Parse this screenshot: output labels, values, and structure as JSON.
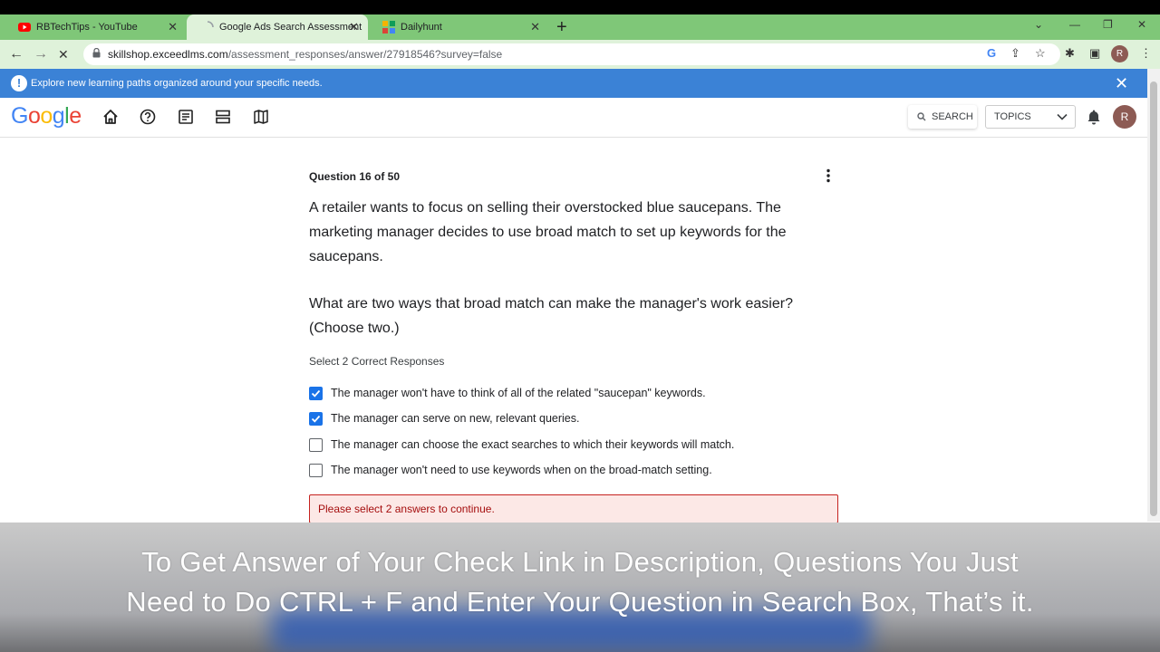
{
  "browser": {
    "tabs": [
      {
        "title": "RBTechTips - YouTube",
        "icon": "youtube-icon"
      },
      {
        "title": "Google Ads Search Assessment",
        "icon": "loading-icon"
      },
      {
        "title": "Dailyhunt",
        "icon": "dailyhunt-icon"
      }
    ],
    "url_host": "skillshop.exceedlms.com",
    "url_path": "/assessment_responses/answer/27918546?survey=false",
    "profile_initial": "R"
  },
  "banner": {
    "text": "Explore new learning paths organized around your specific needs."
  },
  "header": {
    "logo_letters": [
      "G",
      "o",
      "o",
      "g",
      "l",
      "e"
    ],
    "logo_colors": [
      "#4285f4",
      "#ea4335",
      "#fbbc05",
      "#4285f4",
      "#34a853",
      "#ea4335"
    ],
    "search_label": "SEARCH",
    "topics_label": "TOPICS",
    "avatar_initial": "R"
  },
  "question": {
    "number_label": "Question 16 of 50",
    "scenario": "A retailer wants to focus on selling their overstocked blue saucepans. The marketing manager decides to use broad match to set up keywords for the saucepans.",
    "prompt": "What are two ways that broad match can make the manager's work easier? (Choose two.)",
    "instruction": "Select 2 Correct Responses",
    "options": [
      {
        "label": "The manager won't have to think of all of the related \"saucepan\" keywords.",
        "checked": true
      },
      {
        "label": "The manager can serve on new, relevant queries.",
        "checked": true
      },
      {
        "label": "The manager can choose the exact searches to which their keywords will match.",
        "checked": false
      },
      {
        "label": "The manager won't need to use keywords when on the broad-match setting.",
        "checked": false
      }
    ],
    "error_message": "Please select 2 answers to continue."
  },
  "caption": {
    "line1": "To Get Answer of Your Check Link in Description, Questions You Just",
    "line2": "Need to Do CTRL + F and Enter Your Question in Search Box, That’s it."
  }
}
